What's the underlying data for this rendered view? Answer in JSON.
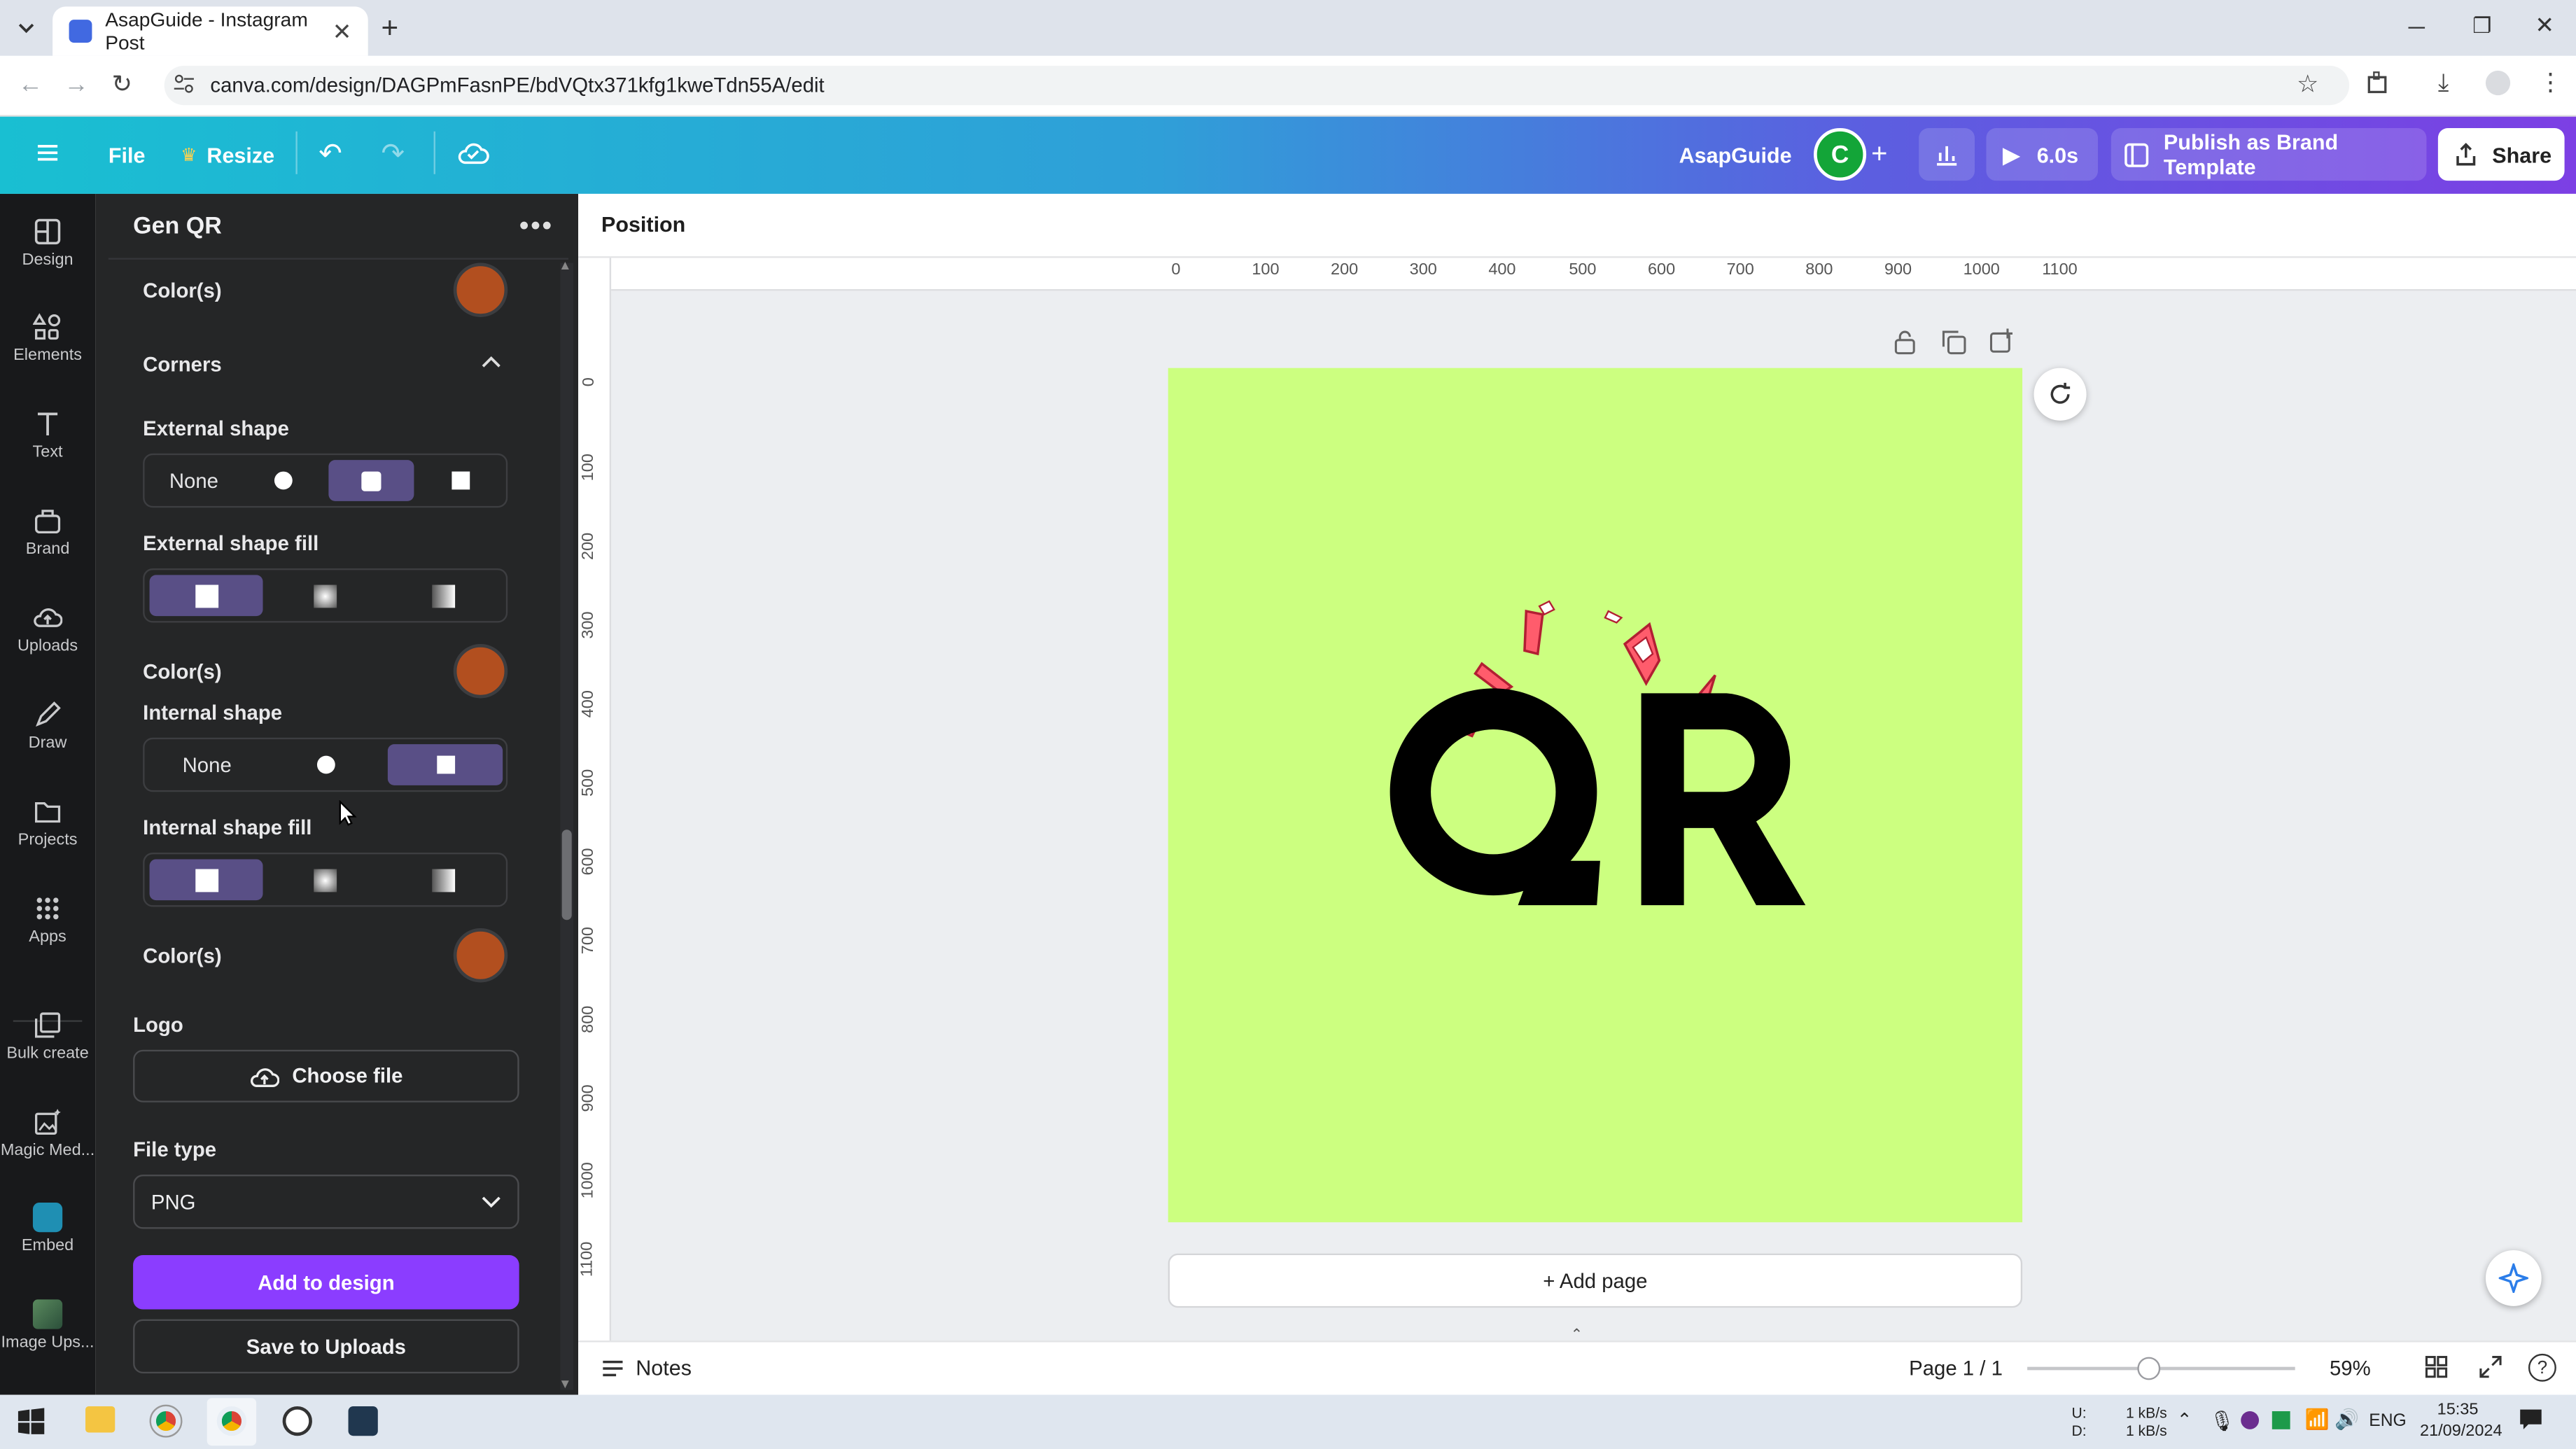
{
  "browser": {
    "tab_title": "AsapGuide - Instagram Post",
    "url": "canva.com/design/DAGPmFasnPE/bdVQtx371kfg1kweTdn55A/edit"
  },
  "toolbar": {
    "file": "File",
    "resize": "Resize",
    "team_name": "AsapGuide",
    "avatar_letter": "C",
    "timer": "6.0s",
    "publish": "Publish as Brand Template",
    "share": "Share"
  },
  "rail": {
    "items": [
      "Design",
      "Elements",
      "Text",
      "Brand",
      "Uploads",
      "Draw",
      "Projects",
      "Apps",
      "Bulk create",
      "Magic Med...",
      "Embed",
      "Image Ups..."
    ]
  },
  "panel": {
    "title": "Gen QR",
    "colors_label": "Color(s)",
    "corners": "Corners",
    "external_shape": "External shape",
    "none": "None",
    "external_shape_fill": "External shape fill",
    "internal_shape": "Internal shape",
    "internal_shape_fill": "Internal shape fill",
    "logo": "Logo",
    "choose_file": "Choose file",
    "file_type": "File type",
    "file_type_value": "PNG",
    "add_to_design": "Add to design",
    "save_to_uploads": "Save to Uploads",
    "swatch_color": "#b24f1f"
  },
  "editor": {
    "context_label": "Position",
    "ruler_h": [
      "0",
      "100",
      "200",
      "300",
      "400",
      "500",
      "600",
      "700",
      "800",
      "900",
      "1000",
      "1100"
    ],
    "ruler_v": [
      "0",
      "100",
      "200",
      "300",
      "400",
      "500",
      "600",
      "700",
      "800",
      "900",
      "1000",
      "1100"
    ],
    "canvas_color": "#ccff80",
    "canvas_text": "QR",
    "add_page": "+ Add page",
    "notes": "Notes",
    "page_indicator": "Page 1 / 1",
    "zoom": "59%"
  },
  "taskbar": {
    "net_up_label": "U:",
    "net_down_label": "D:",
    "net_up": "1 kB/s",
    "net_down": "1 kB/s",
    "lang": "ENG",
    "time": "15:35",
    "date": "21/09/2024"
  }
}
